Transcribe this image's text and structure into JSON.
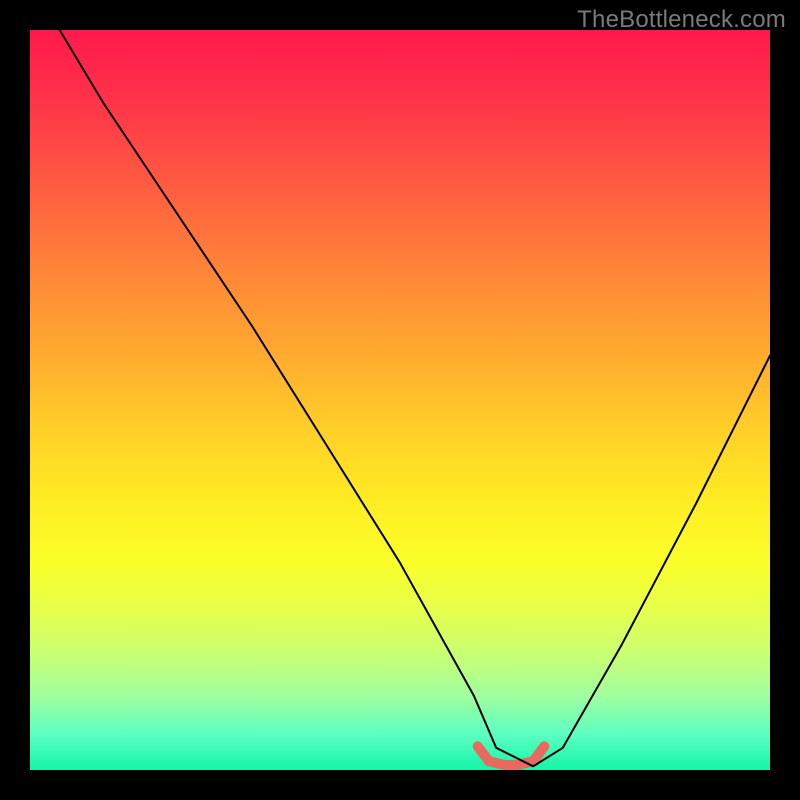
{
  "watermark": "TheBottleneck.com",
  "chart_data": {
    "type": "line",
    "title": "",
    "xlabel": "",
    "ylabel": "",
    "xlim": [
      0,
      100
    ],
    "ylim": [
      0,
      100
    ],
    "background_gradient": {
      "top_color": "#ff1a4d",
      "mid_color": "#ffed24",
      "bottom_color": "#14f5a8"
    },
    "series": [
      {
        "name": "bottleneck-curve",
        "x": [
          4,
          10,
          20,
          30,
          40,
          50,
          55,
          60,
          63,
          68,
          72,
          80,
          90,
          100
        ],
        "y": [
          100,
          90,
          75,
          60,
          44,
          28,
          19,
          10,
          3,
          0.5,
          3,
          17,
          36,
          56
        ],
        "stroke": "#000000",
        "stroke_width": 2
      },
      {
        "name": "optimal-zone-marker",
        "x": [
          60.5,
          62,
          64,
          66,
          68,
          69.5
        ],
        "y": [
          3.2,
          1.2,
          0.7,
          0.7,
          1.2,
          3.2
        ],
        "stroke": "#e86a5f",
        "stroke_width": 10
      }
    ]
  }
}
